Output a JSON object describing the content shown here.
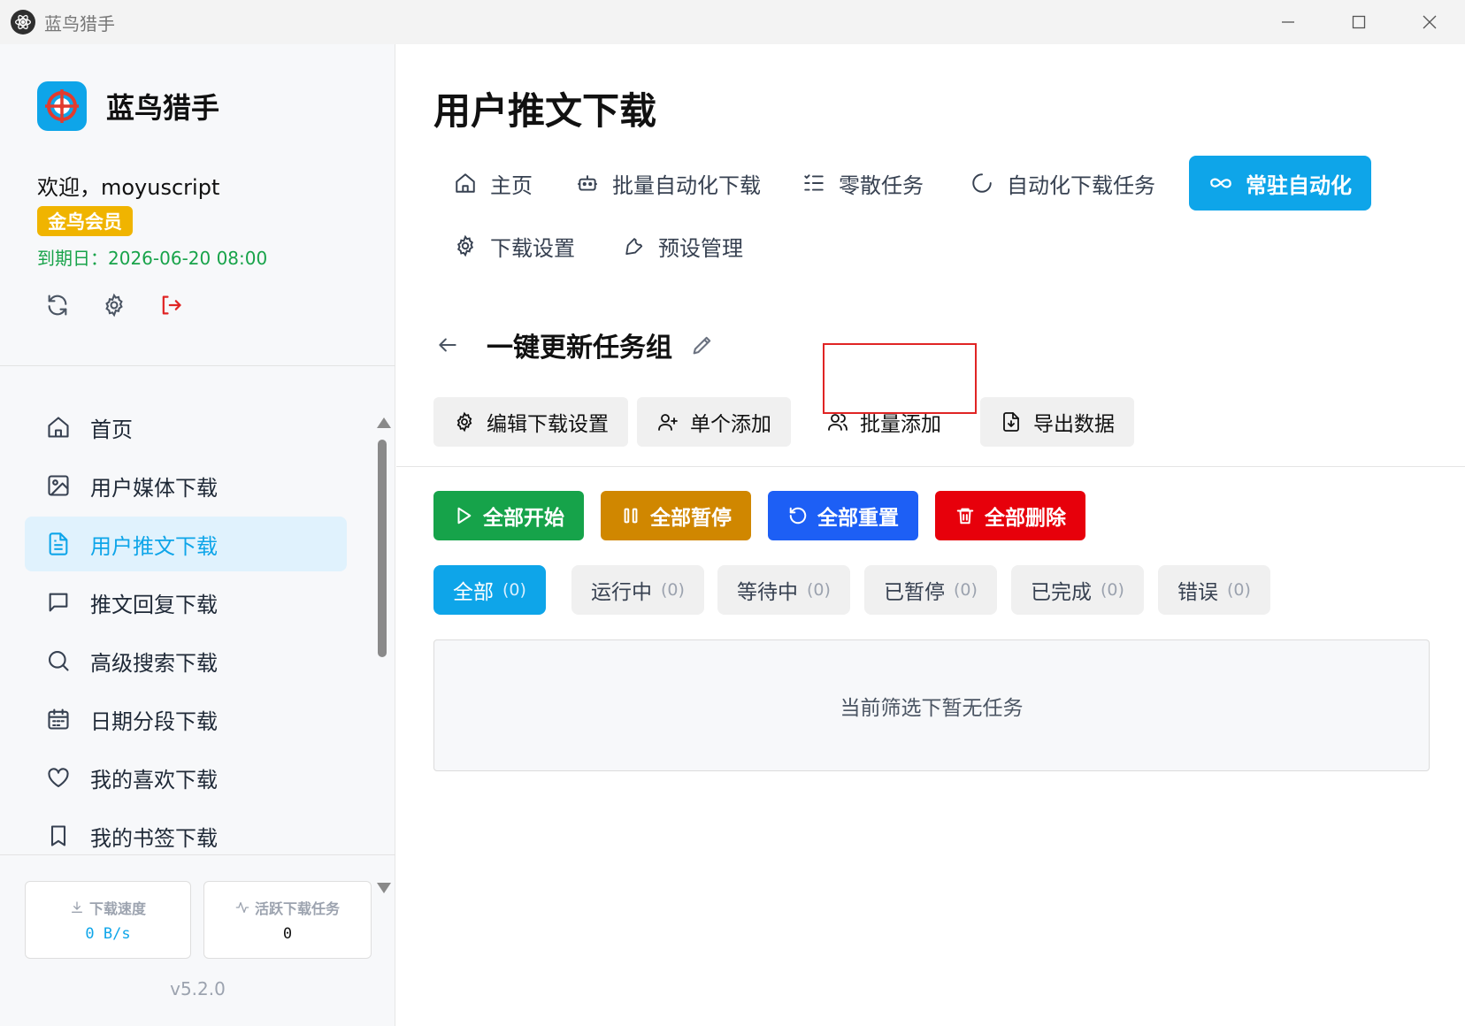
{
  "window": {
    "title": "蓝鸟猎手",
    "icons": {
      "app": "atom-icon",
      "minimize": "minimize-icon",
      "maximize": "maximize-icon",
      "close": "close-icon"
    }
  },
  "sidebar": {
    "brand_name": "蓝鸟猎手",
    "welcome": "欢迎，moyuscript",
    "member_badge": "金鸟会员",
    "expiry": "到期日：2026-06-20 08:00",
    "actions": [
      {
        "name": "refresh-icon"
      },
      {
        "name": "settings-icon"
      },
      {
        "name": "logout-icon",
        "color": "#e02424"
      }
    ],
    "nav": [
      {
        "label": "首页",
        "icon": "home-icon"
      },
      {
        "label": "用户媒体下载",
        "icon": "image-icon"
      },
      {
        "label": "用户推文下载",
        "icon": "document-icon",
        "active": true
      },
      {
        "label": "推文回复下载",
        "icon": "comment-icon"
      },
      {
        "label": "高级搜索下载",
        "icon": "search-icon"
      },
      {
        "label": "日期分段下载",
        "icon": "calendar-icon"
      },
      {
        "label": "我的喜欢下载",
        "icon": "heart-icon"
      },
      {
        "label": "我的书签下载",
        "icon": "bookmark-icon"
      }
    ],
    "stats": {
      "speed_label": "下载速度",
      "speed_value": "0 B/s",
      "active_label": "活跃下载任务",
      "active_value": "0"
    },
    "version": "v5.2.0"
  },
  "main": {
    "page_title": "用户推文下载",
    "tabs": [
      {
        "label": "主页",
        "icon": "home-icon"
      },
      {
        "label": "批量自动化下载",
        "icon": "robot-icon"
      },
      {
        "label": "零散任务",
        "icon": "list-check-icon"
      },
      {
        "label": "自动化下载任务",
        "icon": "loader-icon"
      },
      {
        "label": "常驻自动化",
        "icon": "infinity-icon",
        "active": true
      },
      {
        "label": "下载设置",
        "icon": "gear-icon"
      },
      {
        "label": "预设管理",
        "icon": "wrench-icon"
      }
    ],
    "group_title": "一键更新任务组",
    "ops": [
      {
        "label": "编辑下载设置",
        "icon": "gear-icon"
      },
      {
        "label": "单个添加",
        "icon": "user-plus-icon"
      },
      {
        "label": "批量添加",
        "icon": "users-icon"
      },
      {
        "label": "导出数据",
        "icon": "file-download-icon"
      }
    ],
    "actions": [
      {
        "label": "全部开始",
        "icon": "play-icon",
        "color": "#16a34a"
      },
      {
        "label": "全部暂停",
        "icon": "pause-icon",
        "color": "#d08700"
      },
      {
        "label": "全部重置",
        "icon": "reset-icon",
        "color": "#1d5ff5"
      },
      {
        "label": "全部删除",
        "icon": "trash-icon",
        "color": "#e7000b"
      }
    ],
    "filters": [
      {
        "label": "全部",
        "count": "(0)",
        "active": true
      },
      {
        "label": "运行中",
        "count": "(0)"
      },
      {
        "label": "等待中",
        "count": "(0)"
      },
      {
        "label": "已暂停",
        "count": "(0)"
      },
      {
        "label": "已完成",
        "count": "(0)"
      },
      {
        "label": "错误",
        "count": "(0)"
      }
    ],
    "empty_text": "当前筛选下暂无任务"
  },
  "colors": {
    "accent": "#0ea5e9",
    "accent_light": "#e0f2fd",
    "success": "#16a34a",
    "warning": "#d08700",
    "info": "#1d5ff5",
    "danger": "#e7000b",
    "badge": "#f0b400",
    "expiry": "#18a34a",
    "highlight": "#e02424"
  }
}
